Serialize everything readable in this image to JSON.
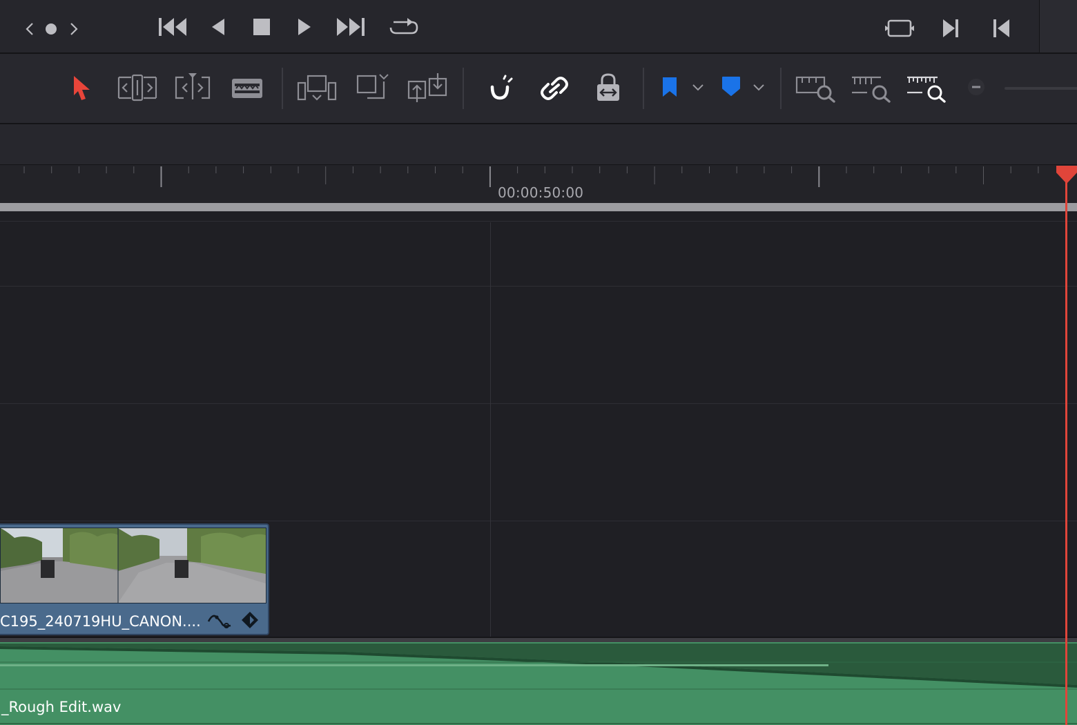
{
  "colors": {
    "playhead": "#e0453a",
    "marker_blue": "#1a73e8",
    "selection_arrow": "#e8453a",
    "video_clip": "#4a6a8c",
    "audio_clip": "#449064"
  },
  "transport": {
    "icons": [
      "chevron-left-icon",
      "dot-icon",
      "chevron-right-icon",
      "skip-to-start-icon",
      "play-reverse-icon",
      "stop-icon",
      "play-icon",
      "skip-to-end-icon",
      "loop-icon",
      "match-frame-icon",
      "next-edit-icon",
      "previous-edit-icon"
    ]
  },
  "toolbar": {
    "icons": [
      "selection-mode-icon",
      "trim-edit-mode-icon",
      "dynamic-trim-mode-icon",
      "blade-edit-mode-icon",
      "insert-clip-icon",
      "overwrite-clip-icon",
      "replace-clip-icon",
      "snapping-icon",
      "linked-selection-icon",
      "position-lock-icon",
      "flag-icon",
      "marker-icon",
      "zoom-full-extent-icon",
      "zoom-detail-icon",
      "zoom-custom-icon",
      "zoom-out-icon"
    ]
  },
  "ruler": {
    "timecode": "00:00:50:00"
  },
  "timeline": {
    "video_clip": {
      "name": "C195_240719HU_CANON...."
    },
    "audio_clip": {
      "name": "_Rough Edit.wav"
    }
  }
}
